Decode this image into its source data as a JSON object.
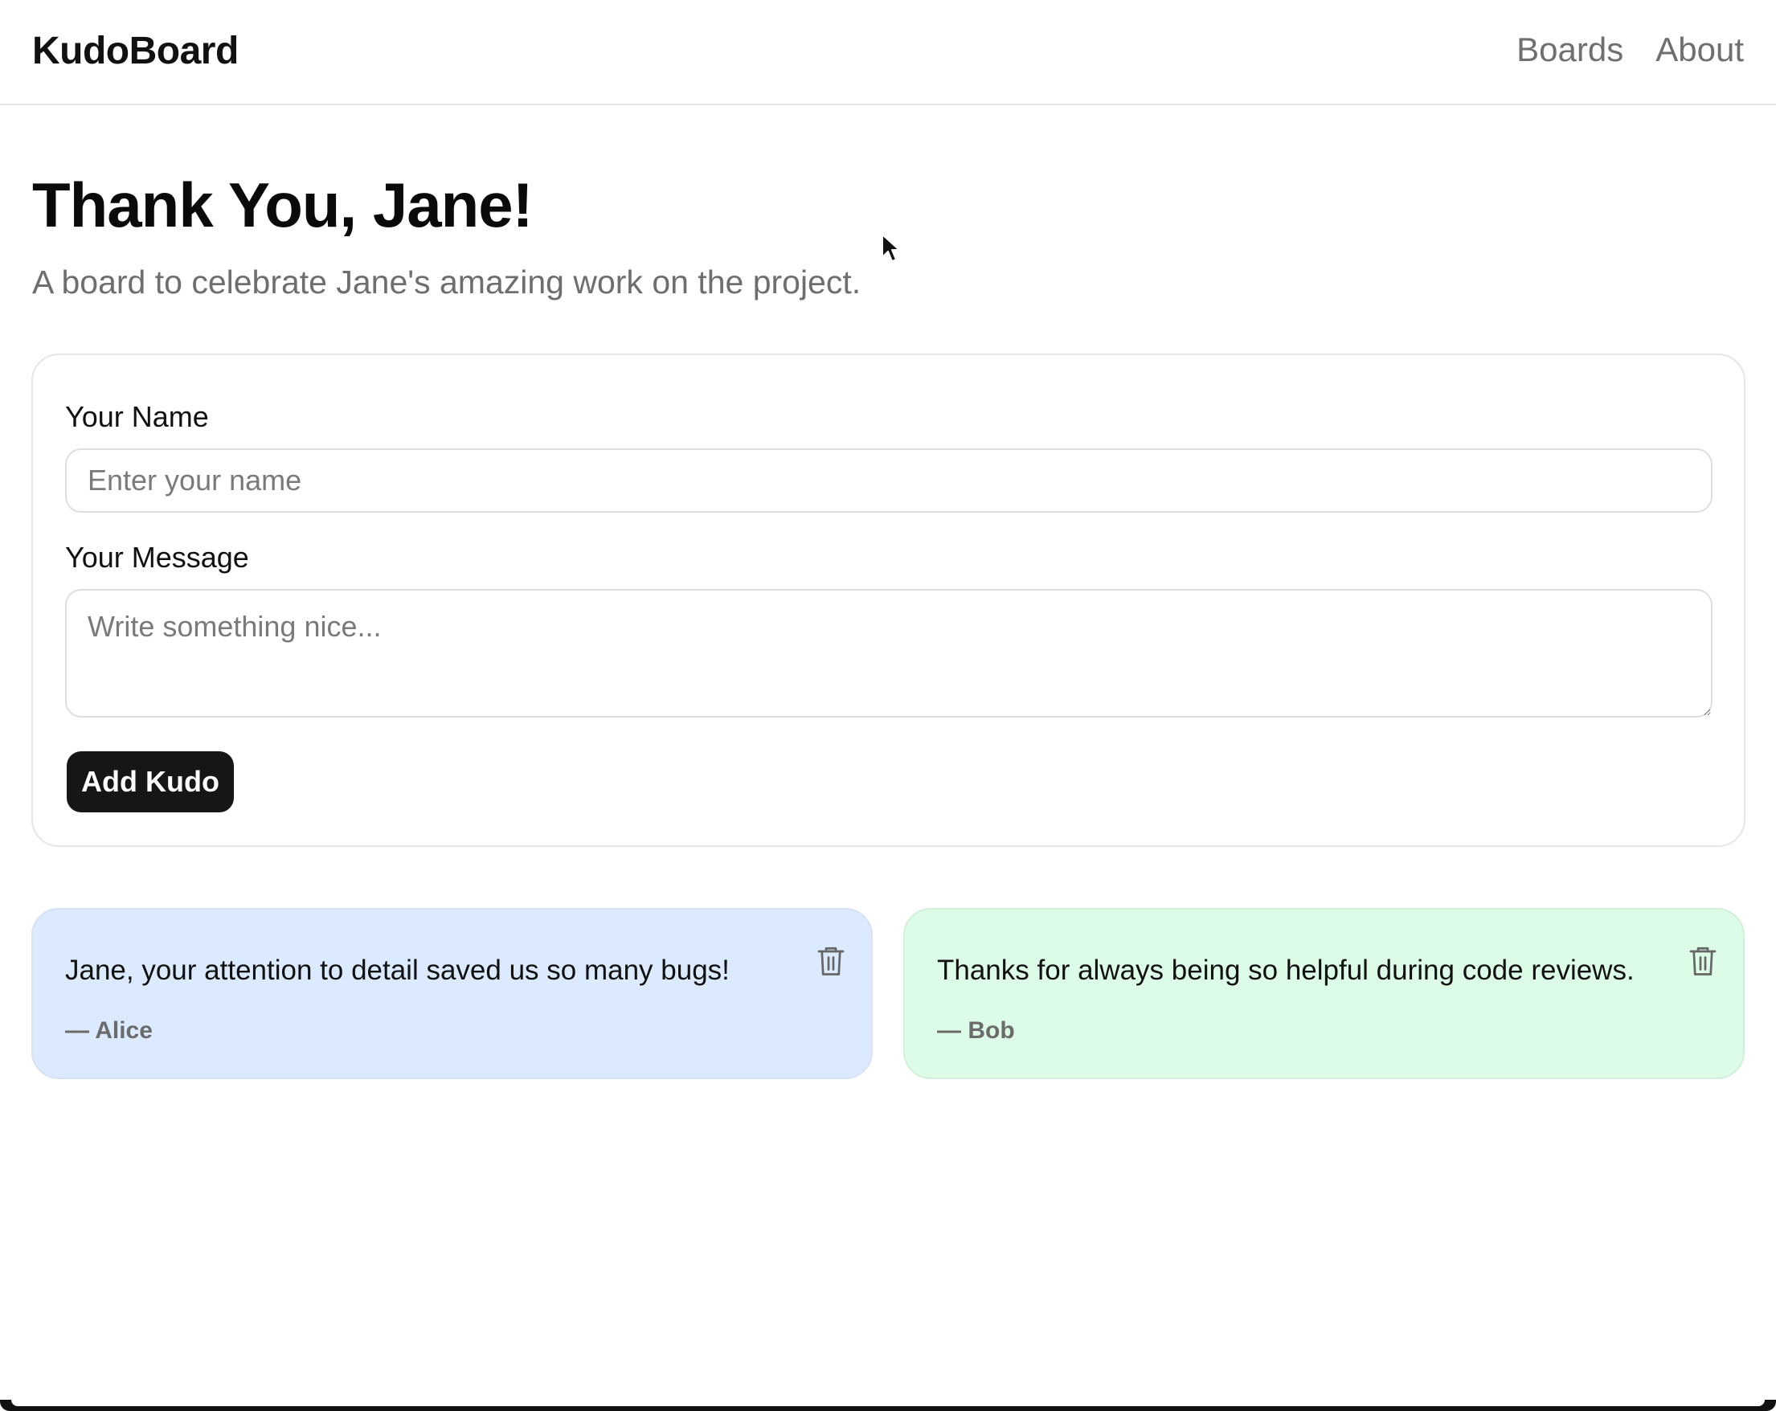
{
  "app": {
    "logo": "KudoBoard"
  },
  "nav": {
    "items": [
      {
        "label": "Boards"
      },
      {
        "label": "About"
      }
    ]
  },
  "board": {
    "title": "Thank You, Jane!",
    "subtitle": "A board to celebrate Jane's amazing work on the project."
  },
  "form": {
    "name_label": "Your Name",
    "name_placeholder": "Enter your name",
    "name_value": "",
    "message_label": "Your Message",
    "message_placeholder": "Write something nice...",
    "message_value": "",
    "submit_label": "Add Kudo"
  },
  "kudos": [
    {
      "message": "Jane, your attention to detail saved us so many bugs!",
      "author": "— Alice",
      "color": "#dbeafe",
      "delete_icon": "trash-icon"
    },
    {
      "message": "Thanks for always being so helpful during code reviews.",
      "author": "— Bob",
      "color": "#dcfce7",
      "delete_icon": "trash-icon"
    }
  ],
  "colors": {
    "primary_button": "#161616",
    "muted_text": "#6e6e6e"
  }
}
